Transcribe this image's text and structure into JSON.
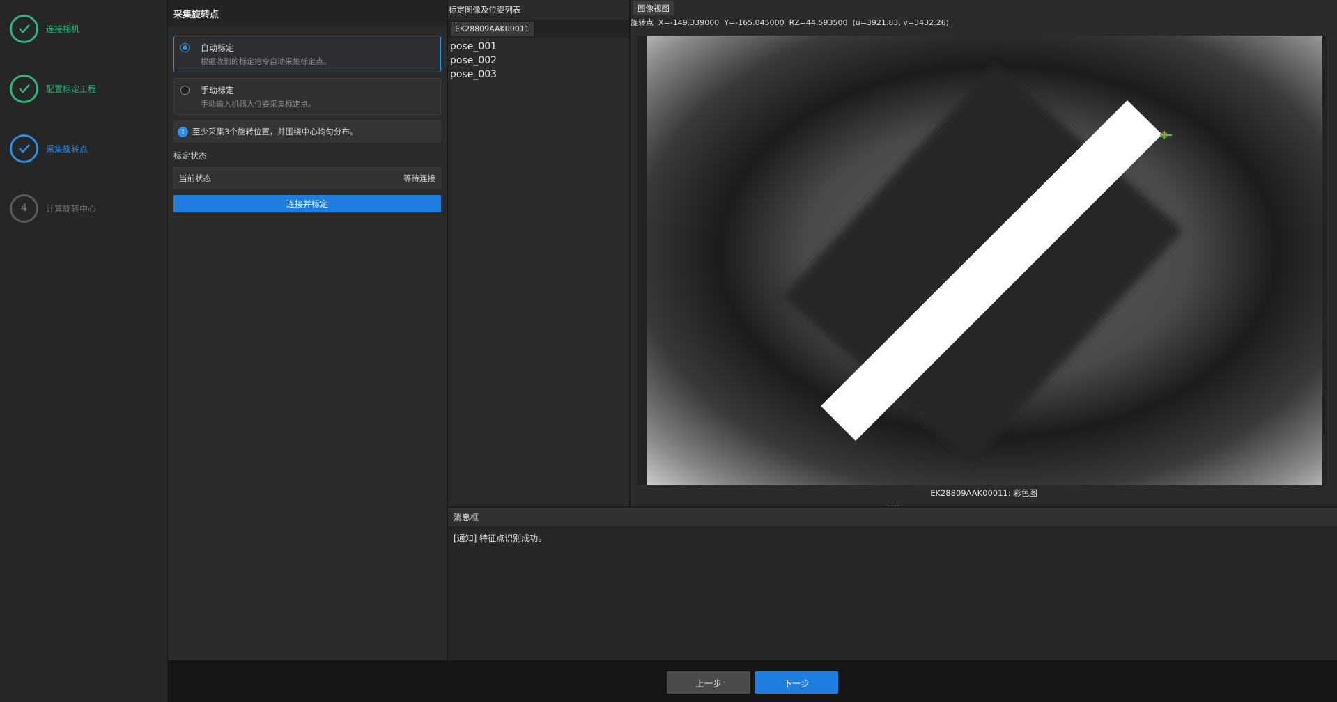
{
  "stepper": {
    "steps": [
      {
        "label": "连接相机",
        "state": "done"
      },
      {
        "label": "配置标定工程",
        "state": "done"
      },
      {
        "label": "采集旋转点",
        "state": "active"
      },
      {
        "label": "计算旋转中心",
        "state": "todo",
        "number": "4"
      }
    ]
  },
  "config": {
    "title": "采集旋转点",
    "auto": {
      "title": "自动标定",
      "desc": "根据收到的标定指令自动采集标定点。",
      "selected": true
    },
    "manual": {
      "title": "手动标定",
      "desc": "手动输入机器人位姿采集标定点。",
      "selected": false
    },
    "info": "至少采集3个旋转位置，并围绕中心均匀分布。",
    "status_section": "标定状态",
    "status_label": "当前状态",
    "status_value": "等待连接",
    "connect_button": "连接并标定"
  },
  "pose_panel": {
    "title": "标定图像及位姿列表",
    "camera_tab": "EK28809AAK00011",
    "poses": [
      "pose_001",
      "pose_002",
      "pose_003"
    ]
  },
  "image_view": {
    "tab": "图像视图",
    "coords": "旋转点  X=-149.339000  Y=-165.045000  RZ=44.593500  (u=3921.83, v=3432.26)",
    "caption": "EK28809AAK00011: 彩色图"
  },
  "messages": {
    "title": "消息框",
    "lines": [
      "[通知] 特征点识别成功。"
    ]
  },
  "footer": {
    "prev": "上一步",
    "next": "下一步"
  },
  "colors": {
    "done": "#2fb37a",
    "active": "#2b8ee8",
    "primary_button": "#1e7ee0"
  }
}
